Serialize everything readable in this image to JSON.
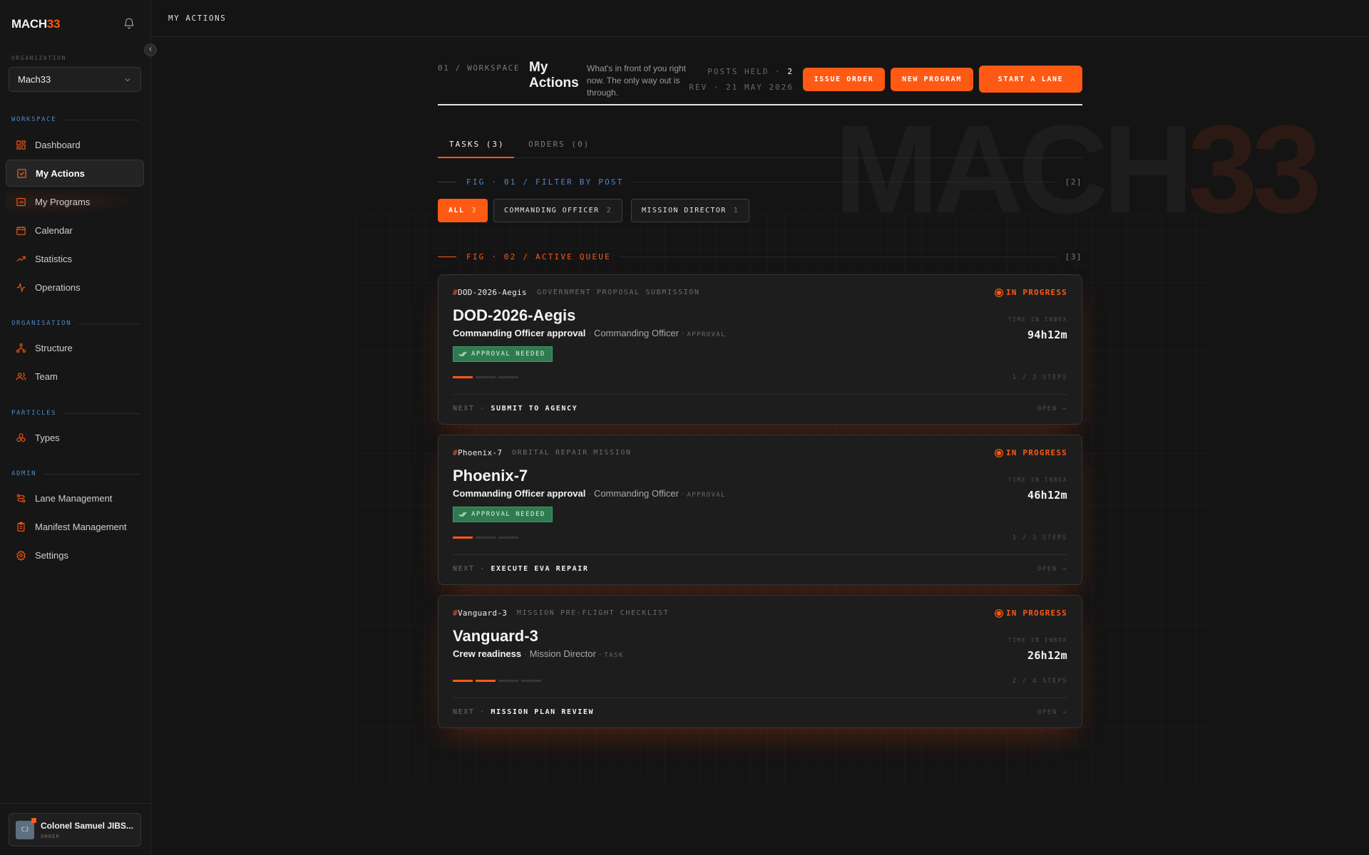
{
  "app": {
    "logo_main": "MACH",
    "logo_accent": "33"
  },
  "sidebar": {
    "org_label": "ORGANIZATION",
    "org_value": "Mach33",
    "sections": {
      "workspace": "WORKSPACE",
      "organisation": "ORGANISATION",
      "particles": "PARTICLES",
      "admin": "ADMIN"
    },
    "items": [
      {
        "label": "Dashboard",
        "icon": "dashboard-icon"
      },
      {
        "label": "My Actions",
        "icon": "check-square-icon",
        "active": true
      },
      {
        "label": "My Programs",
        "icon": "programs-icon"
      },
      {
        "label": "Calendar",
        "icon": "calendar-icon"
      },
      {
        "label": "Statistics",
        "icon": "trend-icon"
      },
      {
        "label": "Operations",
        "icon": "activity-icon"
      },
      {
        "label": "Structure",
        "icon": "structure-icon"
      },
      {
        "label": "Team",
        "icon": "team-icon"
      },
      {
        "label": "Types",
        "icon": "types-icon"
      },
      {
        "label": "Lane Management",
        "icon": "lanes-icon"
      },
      {
        "label": "Manifest Management",
        "icon": "clipboard-icon"
      },
      {
        "label": "Settings",
        "icon": "gear-icon"
      }
    ],
    "user": {
      "initials": "CJ",
      "name": "Colonel Samuel JIBS...",
      "role": "OWNER"
    }
  },
  "topbar": {
    "title": "MY ACTIONS"
  },
  "header": {
    "eyebrow": "01 / WORKSPACE",
    "title": "My Actions",
    "description": "What's in front of you right now. The only way out is through.",
    "posts_label": "POSTS HELD · ",
    "posts_count": "2",
    "revision": "REV · 21 MAY 2026",
    "buttons": {
      "issue_order": "ISSUE ORDER",
      "new_program": "NEW PROGRAM",
      "start_lane": "START A LANE"
    }
  },
  "watermark": {
    "main": "MACH",
    "accent": "33"
  },
  "tabs": [
    {
      "label": "TASKS (3)",
      "active": true
    },
    {
      "label": "ORDERS (0)",
      "active": false
    }
  ],
  "filter": {
    "heading": "FIG · 01 / FILTER BY POST",
    "count": "[2]",
    "chips": [
      {
        "label": "ALL",
        "count": "3",
        "active": true
      },
      {
        "label": "COMMANDING OFFICER",
        "count": "2",
        "active": false
      },
      {
        "label": "MISSION DIRECTOR",
        "count": "1",
        "active": false
      }
    ]
  },
  "queue": {
    "heading": "FIG · 02 / ACTIVE QUEUE",
    "count": "[3]",
    "tasks": [
      {
        "id": "DOD-2026-Aegis",
        "kind": "GOVERNMENT PROPOSAL SUBMISSION",
        "status": "IN PROGRESS",
        "title": "DOD-2026-Aegis",
        "step": "Commanding Officer approval",
        "post": "Commanding Officer",
        "step_type": "APPROVAL",
        "badge": "APPROVAL NEEDED",
        "time_label": "TIME IN INBOX",
        "time": "94h12m",
        "steps_done": 1,
        "steps_total": 3,
        "steps_text": "1 / 3 STEPS",
        "next_label": "NEXT · ",
        "next": "SUBMIT TO AGENCY",
        "open": "OPEN →"
      },
      {
        "id": "Phoenix-7",
        "kind": "ORBITAL REPAIR MISSION",
        "status": "IN PROGRESS",
        "title": "Phoenix-7",
        "step": "Commanding Officer approval",
        "post": "Commanding Officer",
        "step_type": "APPROVAL",
        "badge": "APPROVAL NEEDED",
        "time_label": "TIME IN INBOX",
        "time": "46h12m",
        "steps_done": 1,
        "steps_total": 3,
        "steps_text": "1 / 3 STEPS",
        "next_label": "NEXT · ",
        "next": "EXECUTE EVA REPAIR",
        "open": "OPEN →"
      },
      {
        "id": "Vanguard-3",
        "kind": "MISSION PRE-FLIGHT CHECKLIST",
        "status": "IN PROGRESS",
        "title": "Vanguard-3",
        "step": "Crew readiness",
        "post": "Mission Director",
        "step_type": "TASK",
        "badge": "",
        "time_label": "TIME IN INBOX",
        "time": "26h12m",
        "steps_done": 2,
        "steps_total": 4,
        "steps_text": "2 / 4 STEPS",
        "next_label": "NEXT · ",
        "next": "MISSION PLAN REVIEW",
        "open": "OPEN →"
      }
    ]
  },
  "colors": {
    "accent": "#ff5a14",
    "section": "#4f88c6",
    "success": "#2f7a50",
    "background": "#141414"
  }
}
